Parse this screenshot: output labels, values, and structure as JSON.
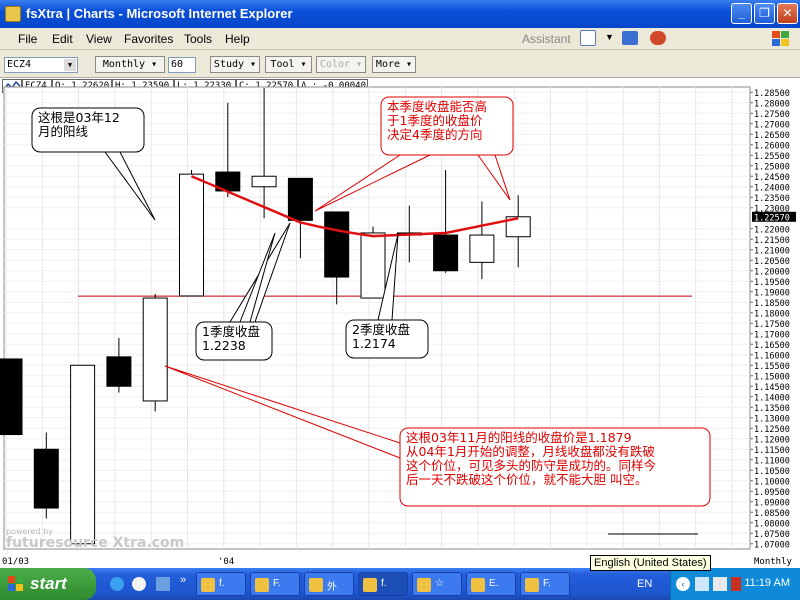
{
  "window": {
    "title": "fsXtra | Charts - Microsoft Internet Explorer"
  },
  "menu": [
    "File",
    "Edit",
    "View",
    "Favorites",
    "Tools",
    "Help"
  ],
  "assistant": "Assistant",
  "toolbar": {
    "symbol": "ECZ4",
    "period": "Monthly",
    "bars": "60",
    "study": "Study",
    "tool": "Tool",
    "color": "Color",
    "more": "More"
  },
  "info": {
    "symbol": "ECZ4",
    "open": "O: 1.22620",
    "high": "H: 1.23590",
    "low": "L: 1.22330",
    "close": "C: 1.22570",
    "delta": "Δ : -0.00040"
  },
  "chart_data": {
    "type": "candlestick",
    "ylim": [
      1.0675,
      1.2875
    ],
    "y_ticks": [
      "1.28500",
      "1.28000",
      "1.27500",
      "1.27000",
      "1.26500",
      "1.26000",
      "1.25500",
      "1.25000",
      "1.24500",
      "1.24000",
      "1.23500",
      "1.23000",
      "1.22570",
      "1.22000",
      "1.21500",
      "1.21000",
      "1.20500",
      "1.20000",
      "1.19500",
      "1.19000",
      "1.18500",
      "1.18000",
      "1.17500",
      "1.17000",
      "1.16500",
      "1.16000",
      "1.15500",
      "1.15000",
      "1.14500",
      "1.14000",
      "1.13500",
      "1.13000",
      "1.12500",
      "1.12000",
      "1.11500",
      "1.11000",
      "1.10500",
      "1.10000",
      "1.09500",
      "1.09000",
      "1.08500",
      "1.08000",
      "1.07500",
      "1.07000"
    ],
    "last_price_label": "1.22570",
    "x_labels": [
      "01/03",
      "'04"
    ],
    "x_right_label": "Monthly",
    "support_level": 1.1879,
    "candles": [
      {
        "open": 1.158,
        "high": 1.158,
        "low": 1.122,
        "close": 1.122
      },
      {
        "open": 1.115,
        "high": 1.123,
        "low": 1.082,
        "close": 1.087
      },
      {
        "open": 1.07,
        "high": 1.155,
        "low": 1.07,
        "close": 1.155
      },
      {
        "open": 1.159,
        "high": 1.168,
        "low": 1.142,
        "close": 1.145
      },
      {
        "open": 1.138,
        "high": 1.189,
        "low": 1.133,
        "close": 1.187
      },
      {
        "open": 1.188,
        "high": 1.248,
        "low": 1.188,
        "close": 1.246
      },
      {
        "open": 1.247,
        "high": 1.28,
        "low": 1.235,
        "close": 1.238
      },
      {
        "open": 1.24,
        "high": 1.287,
        "low": 1.225,
        "close": 1.245
      },
      {
        "open": 1.244,
        "high": 1.244,
        "low": 1.206,
        "close": 1.224
      },
      {
        "open": 1.228,
        "high": 1.228,
        "low": 1.184,
        "close": 1.197
      },
      {
        "open": 1.187,
        "high": 1.221,
        "low": 1.187,
        "close": 1.218
      },
      {
        "open": 1.218,
        "high": 1.231,
        "low": 1.204,
        "close": 1.217
      },
      {
        "open": 1.217,
        "high": 1.248,
        "low": 1.199,
        "close": 1.2
      },
      {
        "open": 1.204,
        "high": 1.233,
        "low": 1.196,
        "close": 1.217
      },
      {
        "open": 1.2162,
        "high": 1.2359,
        "low": 1.2016,
        "close": 1.2257
      }
    ],
    "curve": [
      {
        "i": 5,
        "v": 1.245
      },
      {
        "i": 8,
        "v": 1.223
      },
      {
        "i": 10,
        "v": 1.2165
      },
      {
        "i": 12,
        "v": 1.218
      },
      {
        "i": 14,
        "v": 1.225
      }
    ],
    "annotations": [
      {
        "text_lines": [
          "这根是03年12",
          "月的阳线"
        ],
        "color": "#000"
      },
      {
        "text_lines": [
          "本季度收盘能否高",
          "于1季度的收盘价",
          "决定4季度的方向"
        ],
        "color": "#e00000"
      },
      {
        "text_lines": [
          "1季度收盘",
          "1.2238"
        ],
        "color": "#000"
      },
      {
        "text_lines": [
          "2季度收盘",
          "1.2174"
        ],
        "color": "#000"
      },
      {
        "text_lines": [
          "这根03年11月的阳线的收盘价是1.1879",
          "从04年1月开始的调整，月线收盘都没有跌破",
          "这个价位，可见多头的防守是成功的。同样今",
          "后一天不跌破这个价位，就不能大胆 叫空。"
        ],
        "color": "#e00000"
      }
    ]
  },
  "watermark": "futuresource Xtra.com",
  "watermark_powered": "powered by",
  "taskbar": {
    "start": "start",
    "items": [
      "f.",
      "F.",
      "外",
      "f.",
      "☆",
      "E.",
      "F."
    ],
    "lang": "EN",
    "clock": "11:19 AM",
    "tooltip": "English (United States)"
  }
}
